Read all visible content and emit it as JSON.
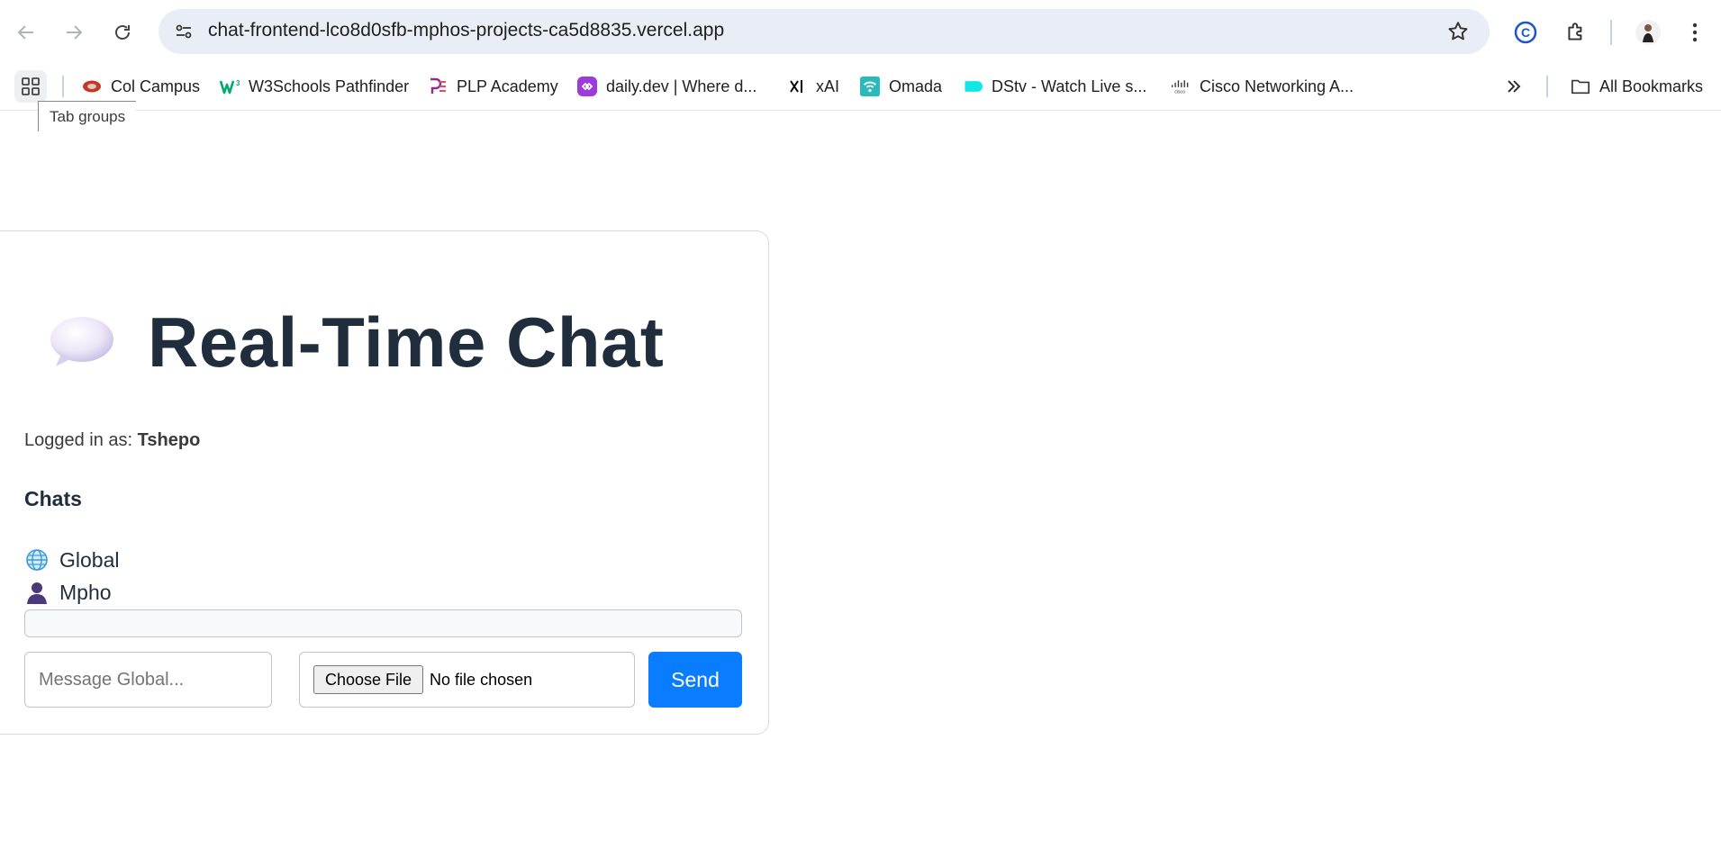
{
  "browser": {
    "url": "chat-frontend-lco8d0sfb-mphos-projects-ca5d8835.vercel.app",
    "icons": [
      "back-arrow-icon",
      "forward-arrow-icon",
      "reload-icon",
      "site-info-icon",
      "bookmark-star-icon",
      "copyright-extension-icon",
      "extensions-puzzle-icon",
      "profile-avatar",
      "more-menu-icon"
    ]
  },
  "bookmarks": {
    "items": [
      {
        "label": "Col Campus",
        "icon": "col-campus-icon",
        "color": "#c0392b"
      },
      {
        "label": "W3Schools Pathfinder",
        "icon": "w3schools-icon",
        "color": "#04aa6d"
      },
      {
        "label": "PLP Academy",
        "icon": "plp-icon",
        "color": "#8e2d8e"
      },
      {
        "label": "daily.dev | Where d...",
        "icon": "dailydev-icon",
        "color": "#9b3bdb"
      },
      {
        "label": "xAI",
        "icon": "xai-icon",
        "color": "#000000"
      },
      {
        "label": "Omada",
        "icon": "omada-icon",
        "color": "#2cb9b9"
      },
      {
        "label": "DStv - Watch Live s...",
        "icon": "dstv-icon",
        "color": "#13e6e6"
      },
      {
        "label": "Cisco Networking A...",
        "icon": "cisco-icon",
        "color": "#333333"
      }
    ],
    "all_bookmarks_label": "All Bookmarks",
    "tooltip": "Tab groups"
  },
  "chat": {
    "title": "Real-Time Chat",
    "logged_in_prefix": "Logged in as:",
    "username": "Tshepo",
    "chats_heading": "Chats",
    "chats": [
      {
        "label": "Global",
        "icon": "globe-icon"
      },
      {
        "label": "Mpho",
        "icon": "user-icon"
      }
    ],
    "message_placeholder": "Message Global...",
    "file_button_label": "Choose File",
    "file_status": "No file chosen",
    "send_label": "Send",
    "accent_color": "#0a7cff"
  }
}
